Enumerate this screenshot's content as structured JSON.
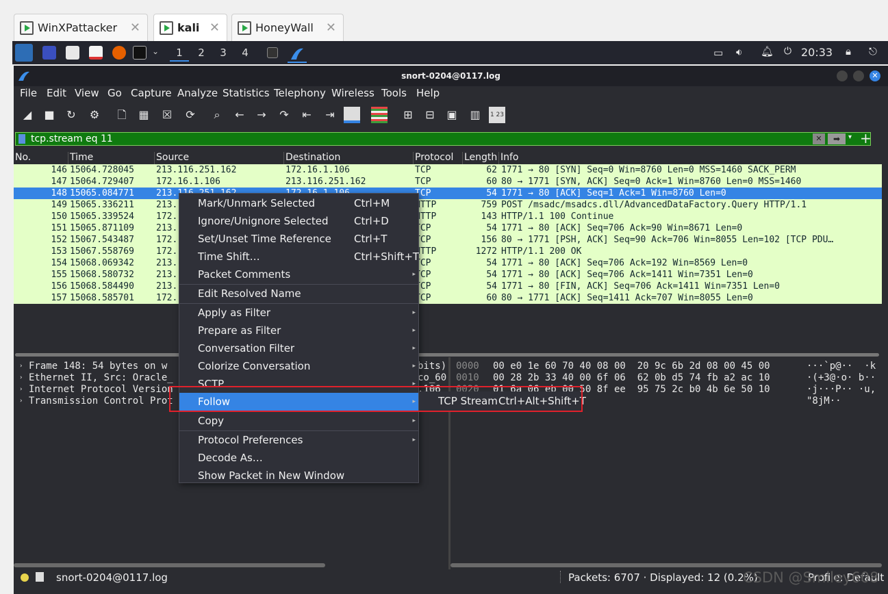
{
  "vm_tabs": [
    {
      "label": "WinXPattacker"
    },
    {
      "label": "kali"
    },
    {
      "label": "HoneyWall"
    }
  ],
  "panel": {
    "workspaces": [
      "1",
      "2",
      "3",
      "4"
    ],
    "clock": "20:33"
  },
  "window": {
    "title": "snort-0204@0117.log"
  },
  "menu": [
    "File",
    "Edit",
    "View",
    "Go",
    "Capture",
    "Analyze",
    "Statistics",
    "Telephony",
    "Wireless",
    "Tools",
    "Help"
  ],
  "filter": {
    "value": "tcp.stream eq 11"
  },
  "columns": [
    "No.",
    "Time",
    "Source",
    "Destination",
    "Protocol",
    "Length",
    "Info"
  ],
  "packets": [
    {
      "no": "146",
      "time": "15064.728045",
      "src": "213.116.251.162",
      "dst": "172.16.1.106",
      "proto": "TCP",
      "len": "62",
      "info": "1771 → 80 [SYN] Seq=0 Win=8760 Len=0 MSS=1460 SACK_PERM"
    },
    {
      "no": "147",
      "time": "15064.729407",
      "src": "172.16.1.106",
      "dst": "213.116.251.162",
      "proto": "TCP",
      "len": "60",
      "info": "80 → 1771 [SYN, ACK] Seq=0 Ack=1 Win=8760 Len=0 MSS=1460"
    },
    {
      "no": "148",
      "time": "15065.084771",
      "src": "213.116.251.162",
      "dst": "172.16.1.106",
      "proto": "TCP",
      "len": "54",
      "info": "1771 → 80 [ACK] Seq=1 Ack=1 Win=8760 Len=0"
    },
    {
      "no": "149",
      "time": "15065.336211",
      "src": "213.",
      "dst": "",
      "proto": "HTTP",
      "len": "759",
      "info": "POST /msadc/msadcs.dll/AdvancedDataFactory.Query HTTP/1.1"
    },
    {
      "no": "150",
      "time": "15065.339524",
      "src": "172.",
      "dst": "",
      "proto": "HTTP",
      "len": "143",
      "info": "HTTP/1.1 100 Continue"
    },
    {
      "no": "151",
      "time": "15065.871109",
      "src": "213.",
      "dst": "",
      "proto": "TCP",
      "len": "54",
      "info": "1771 → 80 [ACK] Seq=706 Ack=90 Win=8671 Len=0"
    },
    {
      "no": "152",
      "time": "15067.543487",
      "src": "172.",
      "dst": "",
      "proto": "TCP",
      "len": "156",
      "info": "80 → 1771 [PSH, ACK] Seq=90 Ack=706 Win=8055 Len=102 [TCP PDU…"
    },
    {
      "no": "153",
      "time": "15067.558769",
      "src": "172.",
      "dst": "",
      "proto": "HTTP",
      "len": "1272",
      "info": "HTTP/1.1 200 OK"
    },
    {
      "no": "154",
      "time": "15068.069342",
      "src": "213.",
      "dst": "",
      "proto": "TCP",
      "len": "54",
      "info": "1771 → 80 [ACK] Seq=706 Ack=192 Win=8569 Len=0"
    },
    {
      "no": "155",
      "time": "15068.580732",
      "src": "213.",
      "dst": "",
      "proto": "TCP",
      "len": "54",
      "info": "1771 → 80 [ACK] Seq=706 Ack=1411 Win=7351 Len=0"
    },
    {
      "no": "156",
      "time": "15068.584490",
      "src": "213.",
      "dst": "",
      "proto": "TCP",
      "len": "54",
      "info": "1771 → 80 [FIN, ACK] Seq=706 Ack=1411 Win=7351 Len=0"
    },
    {
      "no": "157",
      "time": "15068.585701",
      "src": "172.",
      "dst": "",
      "proto": "TCP",
      "len": "60",
      "info": "80 → 1771 [ACK] Seq=1411 Ack=707 Win=8055 Len=0"
    }
  ],
  "details": [
    {
      "left": "Frame 148: 54 bytes on w",
      "right": "bits)"
    },
    {
      "left": "Ethernet II, Src: Oracle_",
      "right": "co_60"
    },
    {
      "left": "Internet Protocol Version",
      "right": ".106"
    },
    {
      "left": "Transmission Control Prot",
      "right": ""
    }
  ],
  "hex": [
    {
      "off": "0000",
      "bytes": "00 e0 1e 60 70 40 08 00  20 9c 6b 2d 08 00 45 00",
      "ascii": "···`p@··  ·k"
    },
    {
      "off": "0010",
      "bytes": "00 28 2b 33 40 00 6f 06  62 0b d5 74 fb a2 ac 10",
      "ascii": "·(+3@·o· b··"
    },
    {
      "off": "0020",
      "bytes": "01 6a 06 eb 00 50 8f ee  95 75 2c b0 4b 6e 50 10",
      "ascii": "·j···P·· ·u,"
    },
    {
      "off": "",
      "bytes": "00",
      "ascii": "\"8jM··"
    }
  ],
  "context_menu": [
    {
      "label": "Mark/Unmark Selected",
      "shortcut": "Ctrl+M",
      "submenu": false
    },
    {
      "label": "Ignore/Unignore Selected",
      "shortcut": "Ctrl+D",
      "submenu": false
    },
    {
      "label": "Set/Unset Time Reference",
      "shortcut": "Ctrl+T",
      "submenu": false
    },
    {
      "label": "Time Shift…",
      "shortcut": "Ctrl+Shift+T",
      "submenu": false
    },
    {
      "label": "Packet Comments",
      "shortcut": "",
      "submenu": true
    },
    {
      "label": "Edit Resolved Name",
      "shortcut": "",
      "submenu": false
    },
    {
      "label": "Apply as Filter",
      "shortcut": "",
      "submenu": true
    },
    {
      "label": "Prepare as Filter",
      "shortcut": "",
      "submenu": true
    },
    {
      "label": "Conversation Filter",
      "shortcut": "",
      "submenu": true
    },
    {
      "label": "Colorize Conversation",
      "shortcut": "",
      "submenu": true
    },
    {
      "label": "SCTP",
      "shortcut": "",
      "submenu": true
    },
    {
      "label": "Follow",
      "shortcut": "",
      "submenu": true
    },
    {
      "label": "Copy",
      "shortcut": "",
      "submenu": true
    },
    {
      "label": "Protocol Preferences",
      "shortcut": "",
      "submenu": true
    },
    {
      "label": "Decode As…",
      "shortcut": "",
      "submenu": false
    },
    {
      "label": "Show Packet in New Window",
      "shortcut": "",
      "submenu": false
    }
  ],
  "follow_submenu": {
    "label": "TCP Stream",
    "shortcut": "Ctrl+Alt+Shift+T"
  },
  "status": {
    "file": "snort-0204@0117.log",
    "packets": "Packets: 6707 · Displayed: 12 (0.2%)",
    "profile": "Profile: Default"
  },
  "watermark": "CSDN @Smiley608",
  "colors": {
    "row_bg": "#e4ffc7",
    "selected_bg": "#3584e4",
    "filter_bg": "#0f7a0f",
    "highlight_box": "#e0212b"
  }
}
